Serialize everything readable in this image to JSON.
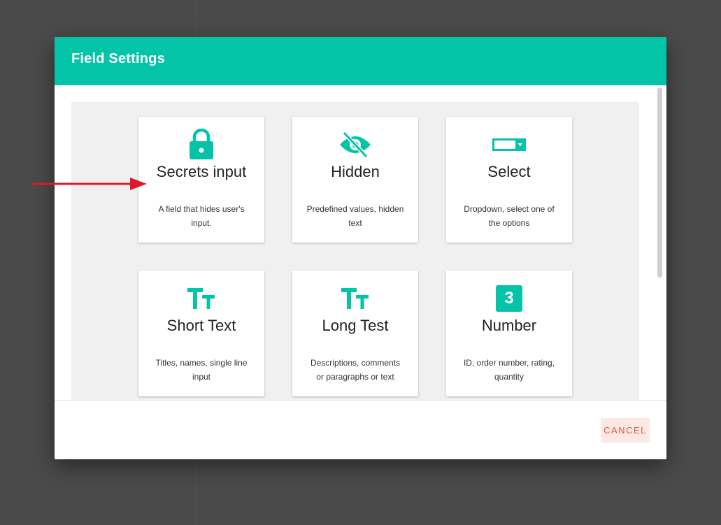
{
  "dialog": {
    "title": "Field Settings",
    "cancel_label": "CANCEL"
  },
  "cards": [
    {
      "icon": "lock-icon",
      "title": "Secrets input",
      "description": "A field that hides user's input."
    },
    {
      "icon": "eye-off-icon",
      "title": "Hidden",
      "description": "Predefined values, hidden text"
    },
    {
      "icon": "select-dropdown-icon",
      "title": "Select",
      "description": "Dropdown, select one of the options"
    },
    {
      "icon": "text-size-icon",
      "title": "Short Text",
      "description": "Titles, names, single line input"
    },
    {
      "icon": "text-size-icon",
      "title": "Long Test",
      "description": "Descriptions, comments or paragraphs or text"
    },
    {
      "icon": "number-3-icon",
      "title": "Number",
      "description": "ID, order number, rating, quantity",
      "icon_text": "3"
    }
  ],
  "colors": {
    "accent": "#04c4a7",
    "overlay": "#4a4a4a",
    "panel": "#f0f0f0",
    "cancel_text": "#e35a3e",
    "cancel_bg": "#fde8e3",
    "annotation_arrow": "#e0182b"
  }
}
